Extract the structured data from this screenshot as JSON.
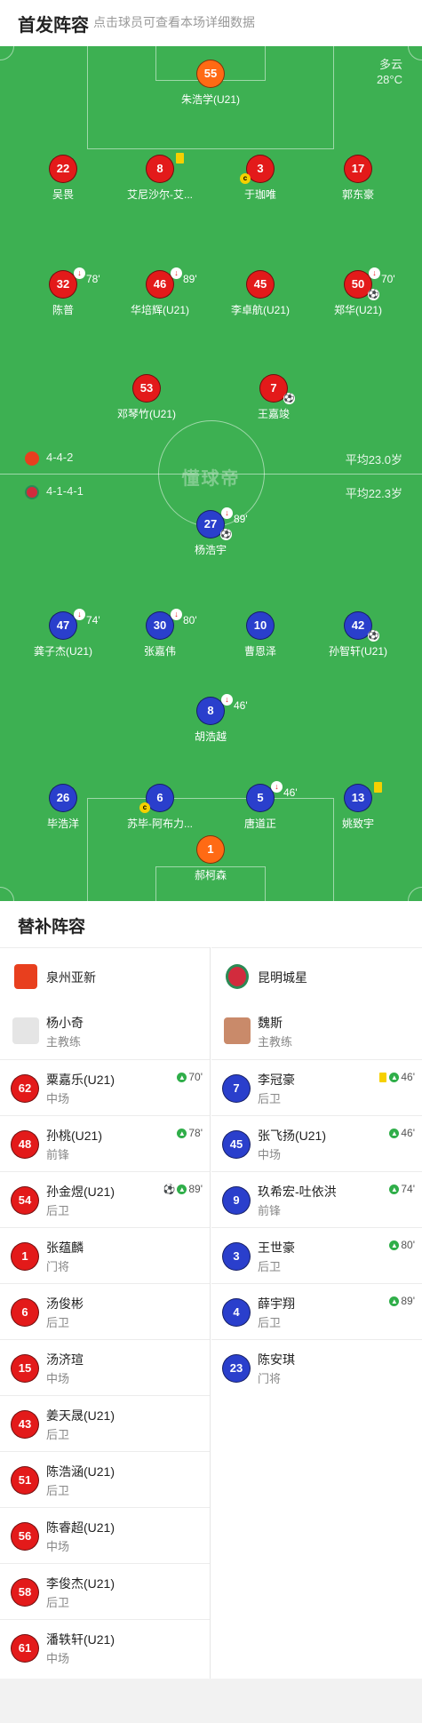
{
  "header": {
    "title": "首发阵容",
    "subtitle": "点击球员可查看本场详细数据"
  },
  "weather": {
    "condition": "多云",
    "temp": "28°C"
  },
  "watermark": "懂球帝",
  "home_team": {
    "formation": "4-4-2",
    "avg_age": "平均23.0岁"
  },
  "away_team": {
    "formation": "4-1-4-1",
    "avg_age": "平均22.3岁"
  },
  "players": [
    {
      "num": "55",
      "name": "朱浩学(U21)",
      "color": "orange"
    },
    {
      "num": "22",
      "name": "吴畏",
      "color": "red"
    },
    {
      "num": "8",
      "name": "艾尼沙尔-艾...",
      "color": "red",
      "yellow": true
    },
    {
      "num": "3",
      "name": "于珈唯",
      "color": "red",
      "captain": "c"
    },
    {
      "num": "17",
      "name": "郭东豪",
      "color": "red"
    },
    {
      "num": "32",
      "name": "陈普",
      "color": "red",
      "sub_min": "78'"
    },
    {
      "num": "46",
      "name": "华培辉(U21)",
      "color": "red",
      "sub_min": "89'"
    },
    {
      "num": "45",
      "name": "李卓航(U21)",
      "color": "red"
    },
    {
      "num": "50",
      "name": "郑华(U21)",
      "color": "red",
      "sub_min": "70'",
      "ball": true
    },
    {
      "num": "53",
      "name": "邓琴竹(U21)",
      "color": "red"
    },
    {
      "num": "7",
      "name": "王嘉竣",
      "color": "red",
      "ball": true
    },
    {
      "num": "27",
      "name": "杨浩宇",
      "color": "blue",
      "sub_min": "89'",
      "ball": true
    },
    {
      "num": "47",
      "name": "龚子杰(U21)",
      "color": "blue",
      "sub_min": "74'"
    },
    {
      "num": "30",
      "name": "张嘉伟",
      "color": "blue",
      "sub_min": "80'"
    },
    {
      "num": "10",
      "name": "曹恩泽",
      "color": "blue"
    },
    {
      "num": "42",
      "name": "孙智轩(U21)",
      "color": "blue",
      "ball": true
    },
    {
      "num": "8",
      "name": "胡浩越",
      "color": "blue",
      "sub_min": "46'"
    },
    {
      "num": "26",
      "name": "毕浩洋",
      "color": "blue"
    },
    {
      "num": "6",
      "name": "苏毕-阿布力...",
      "color": "blue",
      "captain": "c"
    },
    {
      "num": "5",
      "name": "唐道正",
      "color": "blue",
      "sub_min": "46'"
    },
    {
      "num": "13",
      "name": "姚致宇",
      "color": "blue",
      "yellow": true
    },
    {
      "num": "1",
      "name": "郝柯森",
      "color": "orange"
    }
  ],
  "subs": {
    "title": "替补阵容",
    "home": {
      "team": "泉州亚新",
      "coach": {
        "name": "杨小奇",
        "role": "主教练"
      },
      "players": [
        {
          "num": "62",
          "name": "粟嘉乐(U21)",
          "pos": "中场",
          "event": "70'",
          "up": true
        },
        {
          "num": "48",
          "name": "孙桃(U21)",
          "pos": "前锋",
          "event": "78'",
          "up": true
        },
        {
          "num": "54",
          "name": "孙金煜(U21)",
          "pos": "后卫",
          "event": "89'",
          "up": true,
          "goal": true
        },
        {
          "num": "1",
          "name": "张蕴麟",
          "pos": "门将"
        },
        {
          "num": "6",
          "name": "汤俊彬",
          "pos": "后卫"
        },
        {
          "num": "15",
          "name": "汤济瑄",
          "pos": "中场"
        },
        {
          "num": "43",
          "name": "姜天晟(U21)",
          "pos": "后卫"
        },
        {
          "num": "51",
          "name": "陈浩涵(U21)",
          "pos": "后卫"
        },
        {
          "num": "56",
          "name": "陈睿超(U21)",
          "pos": "中场"
        },
        {
          "num": "58",
          "name": "李俊杰(U21)",
          "pos": "后卫"
        },
        {
          "num": "61",
          "name": "潘轶轩(U21)",
          "pos": "中场"
        }
      ]
    },
    "away": {
      "team": "昆明城星",
      "coach": {
        "name": "魏斯",
        "role": "主教练"
      },
      "players": [
        {
          "num": "7",
          "name": "李冠豪",
          "pos": "后卫",
          "event": "46'",
          "up": true,
          "yellow": true
        },
        {
          "num": "45",
          "name": "张飞扬(U21)",
          "pos": "中场",
          "event": "46'",
          "up": true
        },
        {
          "num": "9",
          "name": "玖希宏-吐依洪",
          "pos": "前锋",
          "event": "74'",
          "up": true
        },
        {
          "num": "3",
          "name": "王世豪",
          "pos": "后卫",
          "event": "80'",
          "up": true
        },
        {
          "num": "4",
          "name": "薛宇翔",
          "pos": "后卫",
          "event": "89'",
          "up": true
        },
        {
          "num": "23",
          "name": "陈安琪",
          "pos": "门将"
        }
      ]
    }
  }
}
